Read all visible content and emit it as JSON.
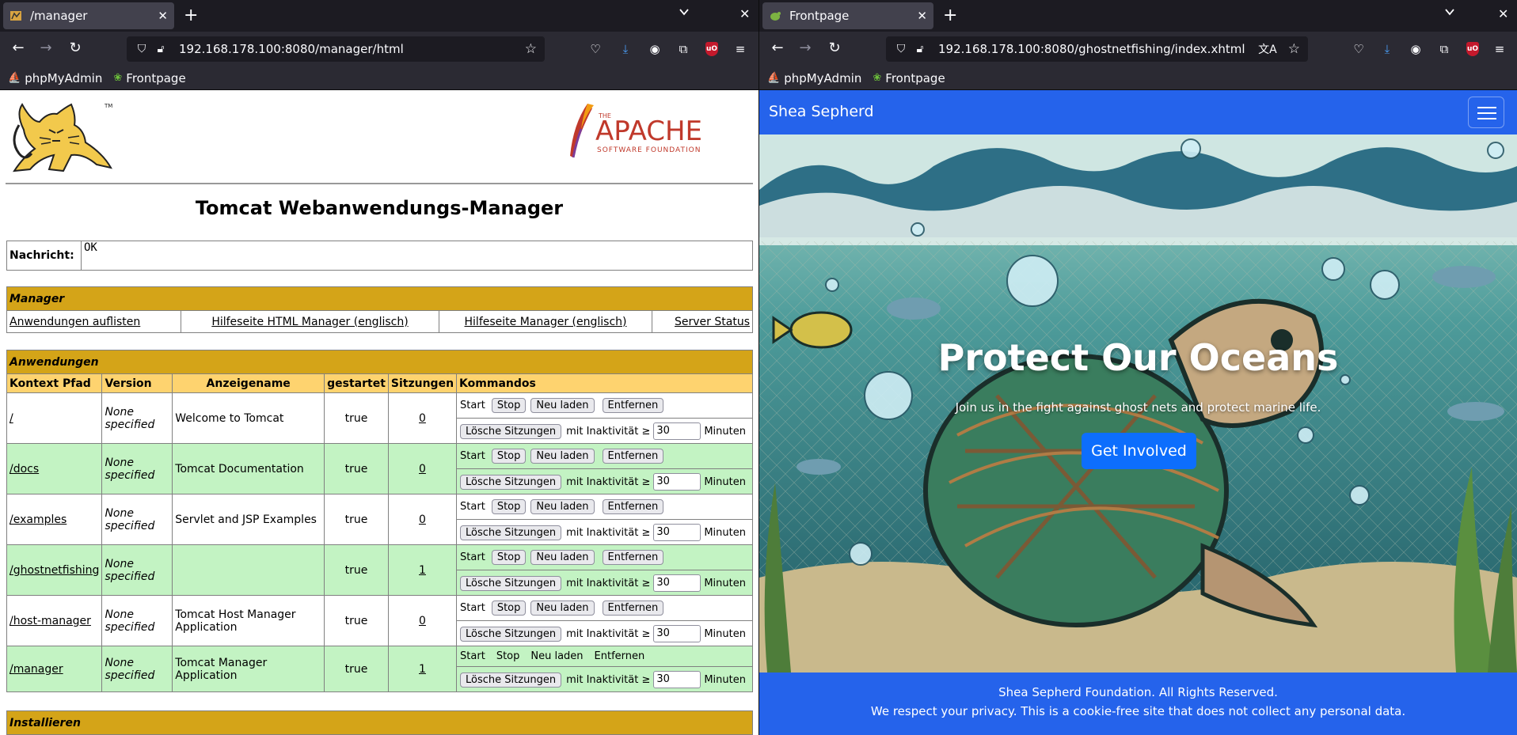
{
  "left": {
    "tab": {
      "title": "/manager",
      "close": "✕"
    },
    "newtab": "+",
    "url": "192.168.178.100:8080/manager/html",
    "bookmarks": [
      {
        "label": "phpMyAdmin",
        "icon": "phpmyadmin-icon"
      },
      {
        "label": "Frontpage",
        "icon": "fish-icon"
      }
    ],
    "tomcat": {
      "title": "Tomcat Webanwendungs-Manager",
      "message_label": "Nachricht:",
      "message_value": "OK",
      "apache_logo": {
        "small": "THE",
        "big": "APACHE",
        "sub": "SOFTWARE FOUNDATION"
      },
      "manager_section": "Manager",
      "manager_links": [
        "Anwendungen auflisten",
        "Hilfeseite HTML Manager (englisch)",
        "Hilfeseite Manager (englisch)",
        "Server Status"
      ],
      "apps_section": "Anwendungen",
      "columns": [
        "Kontext Pfad",
        "Version",
        "Anzeigename",
        "gestartet",
        "Sitzungen",
        "Kommandos"
      ],
      "buttons": {
        "start": "Start",
        "stop": "Stop",
        "reload": "Neu laden",
        "remove": "Entfernen",
        "expire": "Lösche Sitzungen",
        "idle_prefix": "mit Inaktivität ≥",
        "idle_suffix": "Minuten"
      },
      "apps": [
        {
          "path": "/",
          "version": "None specified",
          "name": "Welcome to Tomcat",
          "started": "true",
          "sessions": "0",
          "idle": "30"
        },
        {
          "path": "/docs",
          "version": "None specified",
          "name": "Tomcat Documentation",
          "started": "true",
          "sessions": "0",
          "idle": "30"
        },
        {
          "path": "/examples",
          "version": "None specified",
          "name": "Servlet and JSP Examples",
          "started": "true",
          "sessions": "0",
          "idle": "30"
        },
        {
          "path": "/ghostnetfishing",
          "version": "None specified",
          "name": "",
          "started": "true",
          "sessions": "1",
          "idle": "30"
        },
        {
          "path": "/host-manager",
          "version": "None specified",
          "name": "Tomcat Host Manager Application",
          "started": "true",
          "sessions": "0",
          "idle": "30"
        },
        {
          "path": "/manager",
          "version": "None specified",
          "name": "Tomcat Manager Application",
          "started": "true",
          "sessions": "1",
          "idle": "30"
        }
      ],
      "install_section": "Installieren"
    }
  },
  "right": {
    "tab": {
      "title": "Frontpage",
      "close": "✕"
    },
    "newtab": "+",
    "url": "192.168.178.100:8080/ghostnetfishing/index.xhtml",
    "bookmarks": [
      {
        "label": "phpMyAdmin",
        "icon": "phpmyadmin-icon"
      },
      {
        "label": "Frontpage",
        "icon": "fish-icon"
      }
    ],
    "site": {
      "brand": "Shea Sepherd",
      "hero_title": "Protect Our Oceans",
      "hero_subtitle": "Join us in the fight against ghost nets and protect marine life.",
      "cta": "Get Involved",
      "footer_line1": "Shea Sepherd Foundation. All Rights Reserved.",
      "footer_line2": "We respect your privacy. This is a cookie-free site that does not collect any personal data.",
      "nav_color": "#2563eb",
      "cta_color": "#0d6efd"
    }
  },
  "colors": {
    "chrome_dark": "#1c1b22",
    "chrome_toolbar": "#2b2a33",
    "tomcat_section": "#d4a418",
    "tomcat_header": "#fed36f",
    "tomcat_row_green": "#c3f3c3"
  }
}
